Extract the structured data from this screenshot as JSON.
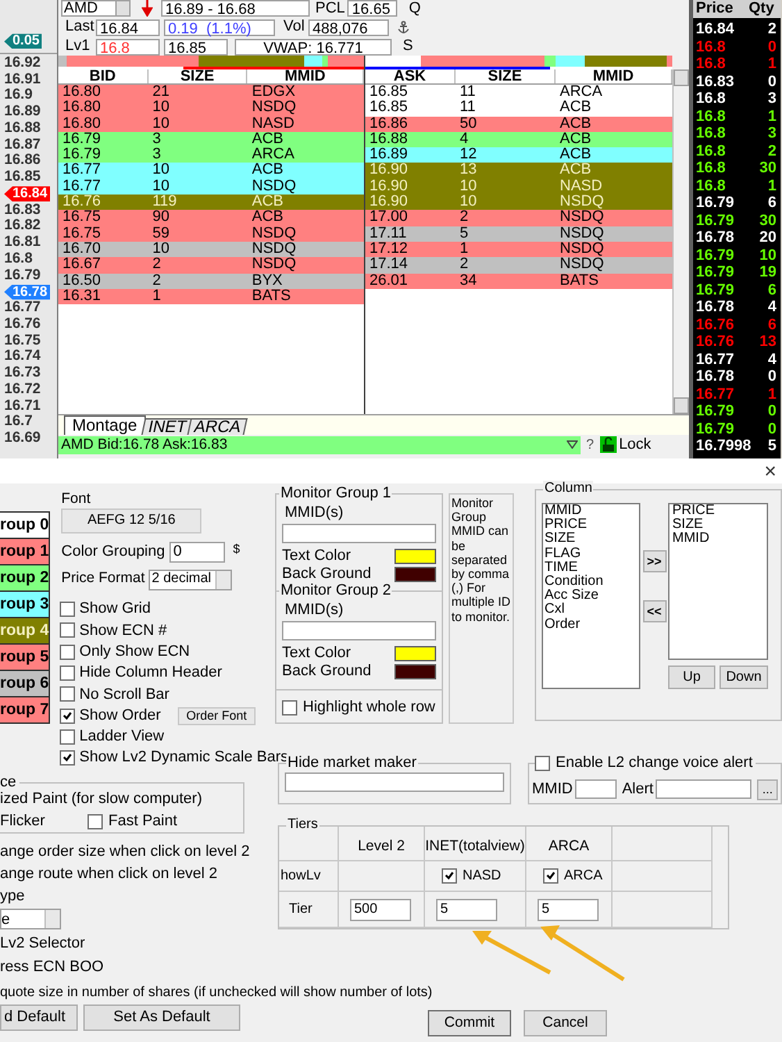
{
  "ladder": [
    {
      "kind": "marker",
      "price": "0.05",
      "color": "#108080"
    },
    {
      "kind": "price",
      "price": "16.92"
    },
    {
      "kind": "price",
      "price": "16.91"
    },
    {
      "kind": "price",
      "price": "16.9"
    },
    {
      "kind": "price",
      "price": "16.89"
    },
    {
      "kind": "price",
      "price": "16.88"
    },
    {
      "kind": "price",
      "price": "16.87"
    },
    {
      "kind": "price",
      "price": "16.86"
    },
    {
      "kind": "price",
      "price": "16.85"
    },
    {
      "kind": "marker",
      "price": "16.84",
      "color": "#ff0000"
    },
    {
      "kind": "price",
      "price": "16.83"
    },
    {
      "kind": "price",
      "price": "16.82"
    },
    {
      "kind": "price",
      "price": "16.81"
    },
    {
      "kind": "price",
      "price": "16.8"
    },
    {
      "kind": "price",
      "price": "16.79"
    },
    {
      "kind": "marker",
      "price": "16.78",
      "color": "#2080ff"
    },
    {
      "kind": "price",
      "price": "16.77"
    },
    {
      "kind": "price",
      "price": "16.76"
    },
    {
      "kind": "price",
      "price": "16.75"
    },
    {
      "kind": "price",
      "price": "16.74"
    },
    {
      "kind": "price",
      "price": "16.73"
    },
    {
      "kind": "price",
      "price": "16.72"
    },
    {
      "kind": "price",
      "price": "16.71"
    },
    {
      "kind": "price",
      "price": "16.7"
    },
    {
      "kind": "price",
      "price": "16.69"
    }
  ],
  "quote": {
    "symbol": "AMD",
    "range": "16.89 - 16.68",
    "pcl_label": "PCL",
    "pcl": "16.65",
    "q": "Q",
    "last_label": "Last",
    "last": "16.84",
    "change": "0.19  (1.1%)",
    "vol_label": "Vol",
    "volume": "488,076",
    "lv1_label": "Lv1",
    "lv1_bid": "16.8",
    "lv1_ask": "16.85",
    "vwap": "VWAP: 16.771",
    "s": "S"
  },
  "scale_bars": {
    "bid_underline": {
      "level": 0.59
    },
    "ask_underline": {
      "level": 0.6
    }
  },
  "bid_book": {
    "columns": [
      "BID",
      "SIZE",
      "MMID"
    ],
    "rows": [
      {
        "price": "16.80",
        "size": "21",
        "mmid": "EDGX",
        "color": "#ff8080"
      },
      {
        "price": "16.80",
        "size": "10",
        "mmid": "NSDQ",
        "color": "#ff8080"
      },
      {
        "price": "16.80",
        "size": "10",
        "mmid": "NASD",
        "color": "#ff8080"
      },
      {
        "price": "16.79",
        "size": "3",
        "mmid": "ACB",
        "color": "#80ff80"
      },
      {
        "price": "16.79",
        "size": "3",
        "mmid": "ARCA",
        "color": "#80ff80"
      },
      {
        "price": "16.77",
        "size": "10",
        "mmid": "ACB",
        "color": "#80ffff"
      },
      {
        "price": "16.77",
        "size": "10",
        "mmid": "NSDQ",
        "color": "#80ffff"
      },
      {
        "price": "16.76",
        "size": "119",
        "mmid": "ACB",
        "color": "#808000"
      },
      {
        "price": "16.75",
        "size": "90",
        "mmid": "ACB",
        "color": "#ff8080"
      },
      {
        "price": "16.75",
        "size": "59",
        "mmid": "NSDQ",
        "color": "#ff8080"
      },
      {
        "price": "16.70",
        "size": "10",
        "mmid": "NSDQ",
        "color": "#c0c0c0"
      },
      {
        "price": "16.67",
        "size": "2",
        "mmid": "NSDQ",
        "color": "#ff8080"
      },
      {
        "price": "16.50",
        "size": "2",
        "mmid": "BYX",
        "color": "#c0c0c0"
      },
      {
        "price": "16.31",
        "size": "1",
        "mmid": "BATS",
        "color": "#ff8080"
      }
    ]
  },
  "ask_book": {
    "columns": [
      "ASK",
      "SIZE",
      "MMID"
    ],
    "rows": [
      {
        "price": "16.85",
        "size": "11",
        "mmid": "ARCA",
        "color": "#ffffff"
      },
      {
        "price": "16.85",
        "size": "11",
        "mmid": "ACB",
        "color": "#ffffff"
      },
      {
        "price": "16.86",
        "size": "50",
        "mmid": "ACB",
        "color": "#ff8080"
      },
      {
        "price": "16.88",
        "size": "4",
        "mmid": "ACB",
        "color": "#80ff80"
      },
      {
        "price": "16.89",
        "size": "12",
        "mmid": "ACB",
        "color": "#80ffff"
      },
      {
        "price": "16.90",
        "size": "13",
        "mmid": "ACB",
        "color": "#808000"
      },
      {
        "price": "16.90",
        "size": "10",
        "mmid": "NASD",
        "color": "#808000"
      },
      {
        "price": "16.90",
        "size": "10",
        "mmid": "NSDQ",
        "color": "#808000"
      },
      {
        "price": "17.00",
        "size": "2",
        "mmid": "NSDQ",
        "color": "#ff8080"
      },
      {
        "price": "17.11",
        "size": "5",
        "mmid": "NSDQ",
        "color": "#c0c0c0"
      },
      {
        "price": "17.12",
        "size": "1",
        "mmid": "NSDQ",
        "color": "#ff8080"
      },
      {
        "price": "17.14",
        "size": "2",
        "mmid": "NSDQ",
        "color": "#c0c0c0"
      },
      {
        "price": "26.01",
        "size": "34",
        "mmid": "BATS",
        "color": "#ff8080"
      }
    ]
  },
  "tabs": [
    {
      "label": "Montage",
      "selected": true
    },
    {
      "label": "INET",
      "selected": false
    },
    {
      "label": "ARCA",
      "selected": false
    }
  ],
  "status_bar": {
    "text": "AMD Bid:16.78 Ask:16.83",
    "help": "?",
    "lock": "Lock"
  },
  "time_sales": {
    "columns": [
      "Price",
      "Qty"
    ],
    "rows": [
      {
        "price": "16.84",
        "qty": "2",
        "color": "#ffffff"
      },
      {
        "price": "16.8",
        "qty": "0",
        "color": "#ff0000"
      },
      {
        "price": "16.8",
        "qty": "1",
        "color": "#ff0000"
      },
      {
        "price": "16.83",
        "qty": "0",
        "color": "#ffffff"
      },
      {
        "price": "16.8",
        "qty": "3",
        "color": "#ffffff"
      },
      {
        "price": "16.8",
        "qty": "1",
        "color": "#66ff00"
      },
      {
        "price": "16.8",
        "qty": "3",
        "color": "#66ff00"
      },
      {
        "price": "16.8",
        "qty": "2",
        "color": "#66ff00"
      },
      {
        "price": "16.8",
        "qty": "30",
        "color": "#66ff00"
      },
      {
        "price": "16.8",
        "qty": "1",
        "color": "#66ff00"
      },
      {
        "price": "16.79",
        "qty": "6",
        "color": "#ffffff"
      },
      {
        "price": "16.79",
        "qty": "30",
        "color": "#66ff00"
      },
      {
        "price": "16.78",
        "qty": "20",
        "color": "#ffffff"
      },
      {
        "price": "16.79",
        "qty": "10",
        "color": "#66ff00"
      },
      {
        "price": "16.79",
        "qty": "19",
        "color": "#66ff00"
      },
      {
        "price": "16.79",
        "qty": "6",
        "color": "#66ff00"
      },
      {
        "price": "16.78",
        "qty": "4",
        "color": "#ffffff"
      },
      {
        "price": "16.76",
        "qty": "6",
        "color": "#ff0000"
      },
      {
        "price": "16.76",
        "qty": "13",
        "color": "#ff0000"
      },
      {
        "price": "16.77",
        "qty": "4",
        "color": "#ffffff"
      },
      {
        "price": "16.78",
        "qty": "0",
        "color": "#ffffff"
      },
      {
        "price": "16.77",
        "qty": "1",
        "color": "#ff0000"
      },
      {
        "price": "16.79",
        "qty": "0",
        "color": "#66ff00"
      },
      {
        "price": "16.79",
        "qty": "0",
        "color": "#66ff00"
      },
      {
        "price": "16.7998",
        "qty": "5",
        "color": "#ffffff"
      }
    ]
  },
  "dialog": {
    "close": "×",
    "groups": [
      {
        "label": "roup 0",
        "color": "#ffffff"
      },
      {
        "label": "roup 1",
        "color": "#ff8080"
      },
      {
        "label": "roup 2",
        "color": "#80ff80"
      },
      {
        "label": "roup 3",
        "color": "#80ffff"
      },
      {
        "label": "roup 4",
        "color": "#808000"
      },
      {
        "label": "roup 5",
        "color": "#ff8080"
      },
      {
        "label": "roup 6",
        "color": "#c0c0c0"
      },
      {
        "label": "roup 7",
        "color": "#ff8080"
      }
    ],
    "font": {
      "label": "Font",
      "sample": "AEFG 12 5/16"
    },
    "color_grouping": {
      "label": "Color Grouping",
      "value": "0",
      "unit": "$"
    },
    "price_format": {
      "label": "Price Format",
      "value": "2 decimal"
    },
    "options": [
      {
        "label": "Show Grid",
        "checked": false
      },
      {
        "label": "Show ECN #",
        "checked": false
      },
      {
        "label": "Only Show ECN",
        "checked": false
      },
      {
        "label": "Hide Column Header",
        "checked": false
      },
      {
        "label": "No Scroll Bar",
        "checked": false
      },
      {
        "label": "Show Order",
        "checked": true,
        "button": "Order Font"
      },
      {
        "label": "Ladder View",
        "checked": false
      },
      {
        "label": "Show Lv2 Dynamic Scale Bars",
        "checked": true
      }
    ],
    "performance": {
      "legend": "ce",
      "line": "ized Paint (for slow computer)",
      "flicker": "Flicker",
      "fast_paint": {
        "label": "Fast Paint",
        "checked": false
      }
    },
    "click_options": [
      "ange order size when click on level 2",
      "ange route when click on level 2"
    ],
    "type": {
      "label": "ype",
      "value": "e"
    },
    "more_options": [
      "Lv2 Selector",
      "ress ECN BOO"
    ],
    "quote_size": "quote size in number of shares (if unchecked will show number of lots)",
    "monitor_groups": [
      {
        "legend": "Monitor Group 1",
        "mmid_label": "MMID(s)",
        "swatches": [
          {
            "label": "Text Color",
            "color": "#ffff00"
          },
          {
            "label": "Back Ground",
            "color": "#400000"
          }
        ]
      },
      {
        "legend": "Monitor Group 2",
        "mmid_label": "MMID(s)",
        "swatches": [
          {
            "label": "Text Color",
            "color": "#ffff00"
          },
          {
            "label": "Back Ground",
            "color": "#400000"
          }
        ]
      }
    ],
    "highlight_whole_row": {
      "label": "Highlight whole row",
      "checked": false
    },
    "monitor_note": "Monitor Group MMID  can be separated by comma (,) For multiple ID to monitor.",
    "column": {
      "legend": "Column",
      "available": [
        "MMID",
        "PRICE",
        "SIZE",
        "FLAG",
        "TIME",
        "Condition",
        "Acc Size",
        "Cxl",
        "Order"
      ],
      "add": ">>",
      "remove": "<<",
      "chosen": [
        "PRICE",
        "SIZE",
        "MMID"
      ],
      "up": "Up",
      "down": "Down"
    },
    "hide_market_maker": {
      "legend": "Hide market maker"
    },
    "voice_alert": {
      "label": "Enable L2 change voice alert",
      "checked": false,
      "mmid_label": "MMID",
      "alert_label": "Alert",
      "browse": "..."
    },
    "tiers": {
      "legend": "Tiers",
      "columns": [
        "Level 2",
        "INET(totalview)",
        "ARCA"
      ],
      "show_label": "howLv",
      "show": [
        {
          "label": "NASD",
          "checked": true
        },
        {
          "label": "ARCA",
          "checked": true
        }
      ],
      "tier_label": "Tier",
      "values": [
        "500",
        "5",
        "5"
      ]
    },
    "buttons": {
      "load_default": "d Default",
      "set_default": "Set As Default",
      "commit": "Commit",
      "cancel": "Cancel"
    }
  }
}
